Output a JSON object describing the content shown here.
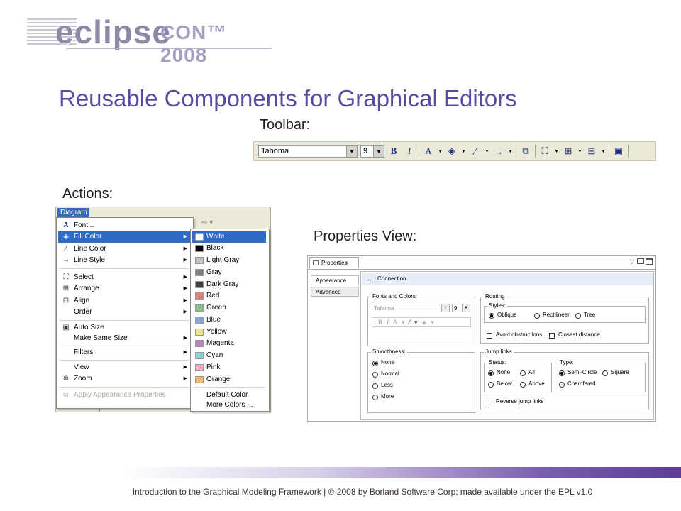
{
  "logo": {
    "eclipse": "eclipse",
    "con": "CON™ 2008"
  },
  "title": "Reusable Components for Graphical Editors",
  "labels": {
    "toolbar": "Toolbar:",
    "actions": "Actions:",
    "properties": "Properties View:"
  },
  "toolbar": {
    "font": "Tahoma",
    "size": "9"
  },
  "diagram_menu": {
    "menubar_label": "Diagram",
    "items": [
      {
        "label": "Font...",
        "icon": "font-icon"
      },
      {
        "label": "Fill Color",
        "icon": "fill-color-icon",
        "submenu": true
      },
      {
        "label": "Line Color",
        "icon": "line-color-icon",
        "submenu": true
      },
      {
        "label": "Line Style",
        "icon": "line-style-icon",
        "submenu": true
      },
      {
        "label": "Select",
        "icon": "select-icon",
        "submenu": true
      },
      {
        "label": "Arrange",
        "icon": "arrange-icon",
        "submenu": true
      },
      {
        "label": "Align",
        "icon": "align-icon",
        "submenu": true
      },
      {
        "label": "Order",
        "icon": "",
        "submenu": true
      },
      {
        "label": "Auto Size",
        "icon": "auto-size-icon"
      },
      {
        "label": "Make Same Size",
        "icon": "",
        "submenu": true
      },
      {
        "label": "Filters",
        "icon": "",
        "submenu": true
      },
      {
        "label": "View",
        "icon": "",
        "submenu": true
      },
      {
        "label": "Zoom",
        "icon": "zoom-icon",
        "submenu": true
      },
      {
        "label": "Apply Appearance Properties",
        "icon": "apply-appearance-icon"
      }
    ]
  },
  "color_menu": {
    "items": [
      {
        "label": "White",
        "color": "#ffffff"
      },
      {
        "label": "Black",
        "color": "#000000"
      },
      {
        "label": "Light Gray",
        "color": "#c0c0c0"
      },
      {
        "label": "Gray",
        "color": "#808080"
      },
      {
        "label": "Dark Gray",
        "color": "#404040"
      },
      {
        "label": "Red",
        "color": "#e3827d"
      },
      {
        "label": "Green",
        "color": "#8fbc8f"
      },
      {
        "label": "Blue",
        "color": "#8aa6d6"
      },
      {
        "label": "Yellow",
        "color": "#eae58c"
      },
      {
        "label": "Magenta",
        "color": "#c080c0"
      },
      {
        "label": "Cyan",
        "color": "#8fd3d3"
      },
      {
        "label": "Pink",
        "color": "#eab0cc"
      },
      {
        "label": "Orange",
        "color": "#eabb6f"
      }
    ],
    "default_color": "Default Color",
    "more_colors": "More Colors ..."
  },
  "properties": {
    "tab_title": "Properties",
    "tabs": [
      "Appearance",
      "Advanced"
    ],
    "header": "Connection",
    "fonts_colors": {
      "title": "Fonts and Colors:",
      "font": "Tahoma",
      "size": "9"
    },
    "routing": {
      "title": "Routing",
      "styles_title": "Styles:",
      "styles": [
        "Oblique",
        "Rectilinear",
        "Tree"
      ],
      "avoid": "Avoid obstructions",
      "closest": "Closest distance"
    },
    "smoothness": {
      "title": "Smoothness:",
      "options": [
        "None",
        "Normal",
        "Less",
        "More"
      ]
    },
    "jump_links": {
      "title": "Jump links",
      "status_title": "Status:",
      "status": [
        "None",
        "All",
        "Below",
        "Above"
      ],
      "type_title": "Type:",
      "types": [
        "Semi-Circle",
        "Square",
        "Chamfered"
      ],
      "reverse": "Reverse jump links"
    }
  },
  "footer": "Introduction to the Graphical Modeling Framework  |  © 2008 by Borland Software Corp; made available under the EPL v1.0"
}
